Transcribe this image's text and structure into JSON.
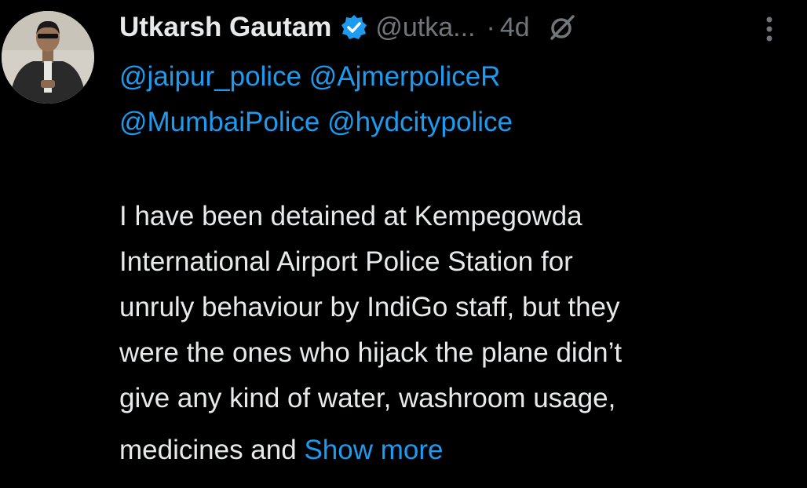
{
  "tweet": {
    "author_name": "Utkarsh Gautam",
    "handle": "@utka...",
    "separator": "·",
    "timestamp": "4d",
    "mentions_line1": [
      "@jaipur_police",
      "@AjmerpoliceR"
    ],
    "mentions_line2": [
      "@MumbaiPolice",
      "@hydcitypolice"
    ],
    "body_lines": [
      "I have been detained at Kempegowda",
      "International Airport Police Station for",
      "unruly behaviour by IndiGo staff, but they",
      "were the ones who hijack the plane didn’t",
      "give any kind of water, washroom usage,",
      "medicines and"
    ],
    "show_more_label": "Show more"
  },
  "colors": {
    "background": "#000000",
    "text": "#e7e9ea",
    "muted": "#71767b",
    "accent": "#1d9bf0"
  },
  "icons": {
    "verified": "verified-badge-icon",
    "grok": "grok-icon",
    "more": "more-vertical-icon"
  }
}
